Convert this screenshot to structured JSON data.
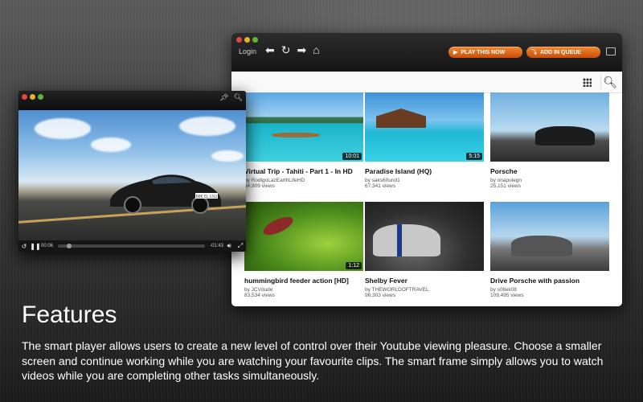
{
  "browser": {
    "login_label": "Login",
    "nav_icons": [
      "back-arrow-icon",
      "refresh-icon",
      "forward-arrow-icon",
      "home-icon"
    ],
    "play_button_label": "PLAY THIS NOW",
    "queue_button_label": "ADD IN QUEUE",
    "accent_color": "#e8701c"
  },
  "videos": [
    {
      "title": "Virtual Trip - Tahiti - Part 1 - In HD",
      "by": "by RodigoLazEarthLifeHD",
      "views": "64,909 views",
      "duration": "10:01"
    },
    {
      "title": "Paradise Island (HQ)",
      "by": "by saks60und1",
      "views": "67,341 views",
      "duration": "5:15"
    },
    {
      "title": "Porsche",
      "by": "by onapulegn",
      "views": "25,151 views",
      "duration": ""
    },
    {
      "title": "hummingbird feeder action [HD]",
      "by": "by JCVdude",
      "views": "83,534 views",
      "duration": "1:12"
    },
    {
      "title": "Shelby Fever",
      "by": "by THEWORLDOFTRAVEL",
      "views": "96,303 views",
      "duration": ""
    },
    {
      "title": "Drive Porsche with passion",
      "by": "by s0ltek08",
      "views": "109,495 views",
      "duration": ""
    }
  ],
  "player": {
    "elapsed": "00:06",
    "remaining": "-01:43",
    "plate_text": "BBE EL 1311",
    "progress_fraction": 0.06
  },
  "features": {
    "title": "Features",
    "body": "The smart player allows users to create a new level of control over their Youtube viewing pleasure. Choose a smaller screen and continue working while you are watching your favourite clips. The smart frame simply allows you to watch videos while you are completing other tasks simultaneously."
  }
}
